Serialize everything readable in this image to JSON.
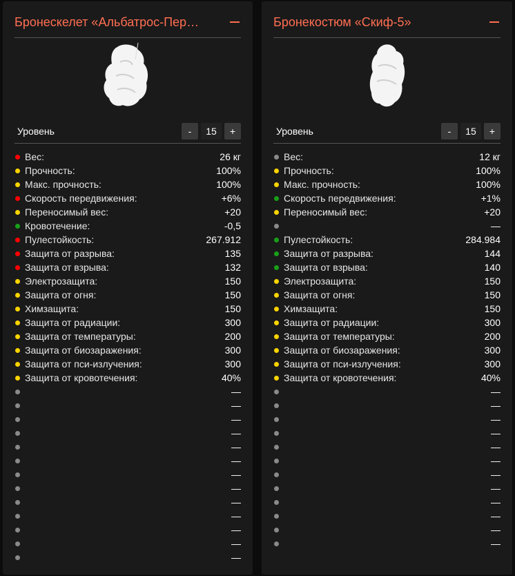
{
  "panels": [
    {
      "title": "Бронескелет «Альбатрос-Пер…",
      "level_label": "Уровень",
      "level_value": "15",
      "minus_label": "-",
      "plus_label": "+",
      "stats": [
        {
          "label": "Вес:",
          "value": "26 кг",
          "color": "red"
        },
        {
          "label": "Прочность:",
          "value": "100%",
          "color": "yellow"
        },
        {
          "label": "Макс. прочность:",
          "value": "100%",
          "color": "yellow"
        },
        {
          "label": "Скорость передвижения:",
          "value": "+6%",
          "color": "red"
        },
        {
          "label": "Переносимый вес:",
          "value": "+20",
          "color": "yellow"
        },
        {
          "label": "Кровотечение:",
          "value": "-0,5",
          "color": "green"
        },
        {
          "label": "Пулестойкость:",
          "value": "267.912",
          "color": "red"
        },
        {
          "label": "Защита от разрыва:",
          "value": "135",
          "color": "red"
        },
        {
          "label": "Защита от взрыва:",
          "value": "132",
          "color": "red"
        },
        {
          "label": "Электрозащита:",
          "value": "150",
          "color": "yellow"
        },
        {
          "label": "Защита от огня:",
          "value": "150",
          "color": "yellow"
        },
        {
          "label": "Химзащита:",
          "value": "150",
          "color": "yellow"
        },
        {
          "label": "Защита от радиации:",
          "value": "300",
          "color": "yellow"
        },
        {
          "label": "Защита от температуры:",
          "value": "200",
          "color": "yellow"
        },
        {
          "label": "Защита от биозаражения:",
          "value": "300",
          "color": "yellow"
        },
        {
          "label": "Защита от пси-излучения:",
          "value": "300",
          "color": "yellow"
        },
        {
          "label": "Защита от кровотечения:",
          "value": "40%",
          "color": "yellow"
        },
        {
          "label": "",
          "value": "—",
          "color": "gray"
        },
        {
          "label": "",
          "value": "—",
          "color": "gray"
        },
        {
          "label": "",
          "value": "—",
          "color": "gray"
        },
        {
          "label": "",
          "value": "—",
          "color": "gray"
        },
        {
          "label": "",
          "value": "—",
          "color": "gray"
        },
        {
          "label": "",
          "value": "—",
          "color": "gray"
        },
        {
          "label": "",
          "value": "—",
          "color": "gray"
        },
        {
          "label": "",
          "value": "—",
          "color": "gray"
        },
        {
          "label": "",
          "value": "—",
          "color": "gray"
        },
        {
          "label": "",
          "value": "—",
          "color": "gray"
        },
        {
          "label": "",
          "value": "—",
          "color": "gray"
        },
        {
          "label": "",
          "value": "—",
          "color": "gray"
        },
        {
          "label": "",
          "value": "—",
          "color": "gray"
        }
      ]
    },
    {
      "title": "Бронекостюм «Скиф-5»",
      "level_label": "Уровень",
      "level_value": "15",
      "minus_label": "-",
      "plus_label": "+",
      "stats": [
        {
          "label": "Вес:",
          "value": "12 кг",
          "color": "gray"
        },
        {
          "label": "Прочность:",
          "value": "100%",
          "color": "yellow"
        },
        {
          "label": "Макс. прочность:",
          "value": "100%",
          "color": "yellow"
        },
        {
          "label": "Скорость передвижения:",
          "value": "+1%",
          "color": "green"
        },
        {
          "label": "Переносимый вес:",
          "value": "+20",
          "color": "yellow"
        },
        {
          "label": "",
          "value": "—",
          "color": "gray"
        },
        {
          "label": "Пулестойкость:",
          "value": "284.984",
          "color": "green"
        },
        {
          "label": "Защита от разрыва:",
          "value": "144",
          "color": "green"
        },
        {
          "label": "Защита от взрыва:",
          "value": "140",
          "color": "green"
        },
        {
          "label": "Электрозащита:",
          "value": "150",
          "color": "yellow"
        },
        {
          "label": "Защита от огня:",
          "value": "150",
          "color": "yellow"
        },
        {
          "label": "Химзащита:",
          "value": "150",
          "color": "yellow"
        },
        {
          "label": "Защита от радиации:",
          "value": "300",
          "color": "yellow"
        },
        {
          "label": "Защита от температуры:",
          "value": "200",
          "color": "yellow"
        },
        {
          "label": "Защита от биозаражения:",
          "value": "300",
          "color": "yellow"
        },
        {
          "label": "Защита от пси-излучения:",
          "value": "300",
          "color": "yellow"
        },
        {
          "label": "Защита от кровотечения:",
          "value": "40%",
          "color": "yellow"
        },
        {
          "label": "",
          "value": "—",
          "color": "gray"
        },
        {
          "label": "",
          "value": "—",
          "color": "gray"
        },
        {
          "label": "",
          "value": "—",
          "color": "gray"
        },
        {
          "label": "",
          "value": "—",
          "color": "gray"
        },
        {
          "label": "",
          "value": "—",
          "color": "gray"
        },
        {
          "label": "",
          "value": "—",
          "color": "gray"
        },
        {
          "label": "",
          "value": "—",
          "color": "gray"
        },
        {
          "label": "",
          "value": "—",
          "color": "gray"
        },
        {
          "label": "",
          "value": "—",
          "color": "gray"
        },
        {
          "label": "",
          "value": "—",
          "color": "gray"
        },
        {
          "label": "",
          "value": "—",
          "color": "gray"
        },
        {
          "label": "",
          "value": "—",
          "color": "gray"
        }
      ]
    }
  ]
}
